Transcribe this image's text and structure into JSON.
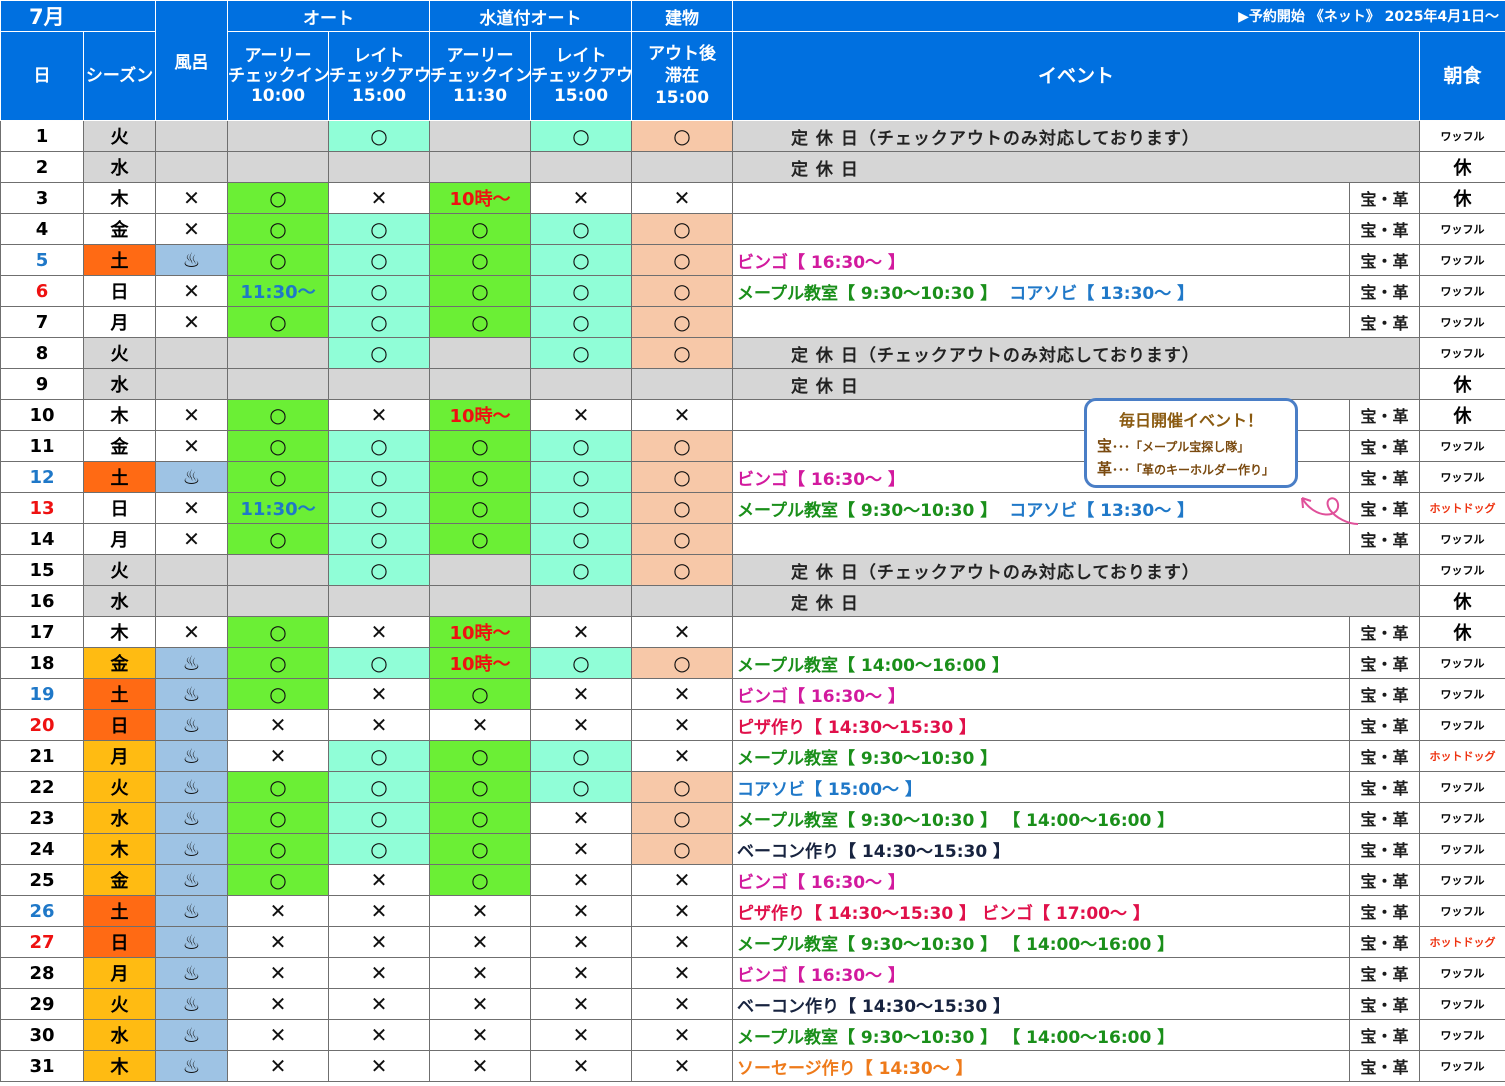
{
  "header": {
    "month": "7月",
    "group_auto": "オート",
    "group_water": "水道付オート",
    "group_building": "建物",
    "notice": "▶予約開始 《ネット》 2025年4月1日～",
    "col_day": "日",
    "col_season": "シーズン",
    "col_bath": "風呂",
    "early_l1": "アーリー",
    "early_l2": "チェックイン",
    "late_l1": "レイト",
    "late_l2": "チェックアウト",
    "auto_early_time": "10:00",
    "auto_late_time": "15:00",
    "water_early_time": "11:30",
    "water_late_time": "15:00",
    "building_l1": "アウト後",
    "building_l2": "滞在",
    "building_time": "15:00",
    "col_event": "イベント",
    "col_breakfast": "朝食"
  },
  "legend": {
    "o": "○",
    "x": "✕",
    "bath": "♨",
    "ten": "10時～",
    "t1130": "11:30～",
    "treasure": "宝・革",
    "waffle": "ワッフル",
    "hotdog": "ホットドッグ",
    "rest": "休"
  },
  "bubble": {
    "title": "毎日開催イベント！",
    "line1_key": "宝",
    "line1_text": "･･･「メープル宝探し隊」",
    "line2_key": "革",
    "line2_text": "･･･「革のキーホルダー作り」"
  },
  "colors": {
    "header_blue": "#0070e0",
    "grey": "#d6d6d6",
    "green": "#6bef35",
    "mint": "#90fed7",
    "peach": "#f7c8a8",
    "bath_blue": "#9ec3e4",
    "saturday_orange": "#ff6a14",
    "peak_amber": "#ffbb12"
  },
  "rows": [
    {
      "day": "1",
      "season": "火",
      "closed": "定 休 日（チェックアウトのみ対応しております）",
      "breakfast": "ワッフル"
    },
    {
      "day": "2",
      "season": "水",
      "closed": "定 休 日",
      "breakfast": "休"
    },
    {
      "day": "3",
      "season": "木",
      "bath": "✕",
      "ae": "○",
      "al": "✕",
      "we": "10時～",
      "wl": "✕",
      "bd": "✕",
      "event": "",
      "treasure": "宝・革",
      "breakfast": "休"
    },
    {
      "day": "4",
      "season": "金",
      "bath": "✕",
      "ae": "○",
      "al": "○",
      "we": "○",
      "wl": "○",
      "bd": "○",
      "event": "",
      "treasure": "宝・革",
      "breakfast": "ワッフル"
    },
    {
      "day": "5",
      "season": "土",
      "bath": "♨",
      "ae": "○",
      "al": "○",
      "we": "○",
      "wl": "○",
      "bd": "○",
      "event": "ビンゴ【 16:30～ 】",
      "treasure": "宝・革",
      "breakfast": "ワッフル"
    },
    {
      "day": "6",
      "season": "日",
      "bath": "✕",
      "ae": "11:30～",
      "al": "○",
      "we": "○",
      "wl": "○",
      "bd": "○",
      "event": "メープル教室【 9:30～10:30 】",
      "event2": "コアソビ【 13:30～ 】",
      "treasure": "宝・革",
      "breakfast": "ワッフル"
    },
    {
      "day": "7",
      "season": "月",
      "bath": "✕",
      "ae": "○",
      "al": "○",
      "we": "○",
      "wl": "○",
      "bd": "○",
      "event": "",
      "treasure": "宝・革",
      "breakfast": "ワッフル"
    },
    {
      "day": "8",
      "season": "火",
      "closed": "定 休 日（チェックアウトのみ対応しております）",
      "breakfast": "ワッフル"
    },
    {
      "day": "9",
      "season": "水",
      "closed": "定 休 日",
      "breakfast": "休"
    },
    {
      "day": "10",
      "season": "木",
      "bath": "✕",
      "ae": "○",
      "al": "✕",
      "we": "10時～",
      "wl": "✕",
      "bd": "✕",
      "event": "",
      "treasure": "宝・革",
      "breakfast": "休"
    },
    {
      "day": "11",
      "season": "金",
      "bath": "✕",
      "ae": "○",
      "al": "○",
      "we": "○",
      "wl": "○",
      "bd": "○",
      "event": "",
      "treasure": "宝・革",
      "breakfast": "ワッフル"
    },
    {
      "day": "12",
      "season": "土",
      "bath": "♨",
      "ae": "○",
      "al": "○",
      "we": "○",
      "wl": "○",
      "bd": "○",
      "event": "ビンゴ【 16:30～ 】",
      "treasure": "宝・革",
      "breakfast": "ワッフル"
    },
    {
      "day": "13",
      "season": "日",
      "bath": "✕",
      "ae": "11:30～",
      "al": "○",
      "we": "○",
      "wl": "○",
      "bd": "○",
      "event": "メープル教室【 9:30～10:30 】",
      "event2": "コアソビ【 13:30～ 】",
      "treasure": "宝・革",
      "breakfast": "ホットドッグ"
    },
    {
      "day": "14",
      "season": "月",
      "bath": "✕",
      "ae": "○",
      "al": "○",
      "we": "○",
      "wl": "○",
      "bd": "○",
      "event": "",
      "treasure": "宝・革",
      "breakfast": "ワッフル"
    },
    {
      "day": "15",
      "season": "火",
      "closed": "定 休 日（チェックアウトのみ対応しております）",
      "breakfast": "ワッフル"
    },
    {
      "day": "16",
      "season": "水",
      "closed": "定 休 日",
      "breakfast": "休"
    },
    {
      "day": "17",
      "season": "木",
      "bath": "✕",
      "ae": "○",
      "al": "✕",
      "we": "10時～",
      "wl": "✕",
      "bd": "✕",
      "event": "",
      "treasure": "宝・革",
      "breakfast": "休"
    },
    {
      "day": "18",
      "season": "金",
      "bath": "♨",
      "ae": "○",
      "al": "○",
      "we": "10時～",
      "wl": "○",
      "bd": "○",
      "event": "メープル教室【 14:00～16:00 】",
      "treasure": "宝・革",
      "breakfast": "ワッフル"
    },
    {
      "day": "19",
      "season": "土",
      "bath": "♨",
      "ae": "○",
      "al": "✕",
      "we": "○",
      "wl": "✕",
      "bd": "✕",
      "event": "ビンゴ【 16:30～ 】",
      "treasure": "宝・革",
      "breakfast": "ワッフル"
    },
    {
      "day": "20",
      "season": "日",
      "bath": "♨",
      "ae": "✕",
      "al": "✕",
      "we": "✕",
      "wl": "✕",
      "bd": "✕",
      "event": "ピザ作り【 14:30～15:30 】",
      "treasure": "宝・革",
      "breakfast": "ワッフル"
    },
    {
      "day": "21",
      "season": "月",
      "bath": "♨",
      "ae": "✕",
      "al": "○",
      "we": "○",
      "wl": "○",
      "bd": "✕",
      "event": "メープル教室【 9:30～10:30 】",
      "treasure": "宝・革",
      "breakfast": "ホットドッグ"
    },
    {
      "day": "22",
      "season": "火",
      "bath": "♨",
      "ae": "○",
      "al": "○",
      "we": "○",
      "wl": "○",
      "bd": "○",
      "event": "コアソビ【 15:00～ 】",
      "treasure": "宝・革",
      "breakfast": "ワッフル"
    },
    {
      "day": "23",
      "season": "水",
      "bath": "♨",
      "ae": "○",
      "al": "○",
      "we": "○",
      "wl": "✕",
      "bd": "○",
      "event": "メープル教室【 9:30～10:30 】 【 14:00～16:00 】",
      "treasure": "宝・革",
      "breakfast": "ワッフル"
    },
    {
      "day": "24",
      "season": "木",
      "bath": "♨",
      "ae": "○",
      "al": "○",
      "we": "○",
      "wl": "✕",
      "bd": "○",
      "event": "ベーコン作り【 14:30～15:30 】",
      "treasure": "宝・革",
      "breakfast": "ワッフル"
    },
    {
      "day": "25",
      "season": "金",
      "bath": "♨",
      "ae": "○",
      "al": "✕",
      "we": "○",
      "wl": "✕",
      "bd": "✕",
      "event": "ビンゴ【 16:30～ 】",
      "treasure": "宝・革",
      "breakfast": "ワッフル"
    },
    {
      "day": "26",
      "season": "土",
      "bath": "♨",
      "ae": "✕",
      "al": "✕",
      "we": "✕",
      "wl": "✕",
      "bd": "✕",
      "event": "ピザ作り【 14:30～15:30 】 ビンゴ【 17:00～ 】",
      "treasure": "宝・革",
      "breakfast": "ワッフル"
    },
    {
      "day": "27",
      "season": "日",
      "bath": "♨",
      "ae": "✕",
      "al": "✕",
      "we": "✕",
      "wl": "✕",
      "bd": "✕",
      "event": "メープル教室【 9:30～10:30 】 【 14:00～16:00 】",
      "treasure": "宝・革",
      "breakfast": "ホットドッグ"
    },
    {
      "day": "28",
      "season": "月",
      "bath": "♨",
      "ae": "✕",
      "al": "✕",
      "we": "✕",
      "wl": "✕",
      "bd": "✕",
      "event": "ビンゴ【 16:30～ 】",
      "treasure": "宝・革",
      "breakfast": "ワッフル"
    },
    {
      "day": "29",
      "season": "火",
      "bath": "♨",
      "ae": "✕",
      "al": "✕",
      "we": "✕",
      "wl": "✕",
      "bd": "✕",
      "event": "ベーコン作り【 14:30～15:30 】",
      "treasure": "宝・革",
      "breakfast": "ワッフル"
    },
    {
      "day": "30",
      "season": "水",
      "bath": "♨",
      "ae": "✕",
      "al": "✕",
      "we": "✕",
      "wl": "✕",
      "bd": "✕",
      "event": "メープル教室【 9:30～10:30 】 【 14:00～16:00 】",
      "treasure": "宝・革",
      "breakfast": "ワッフル"
    },
    {
      "day": "31",
      "season": "木",
      "bath": "♨",
      "ae": "✕",
      "al": "✕",
      "we": "✕",
      "wl": "✕",
      "bd": "✕",
      "event": "ソーセージ作り【 14:30～ 】",
      "treasure": "宝・革",
      "breakfast": "ワッフル"
    }
  ]
}
